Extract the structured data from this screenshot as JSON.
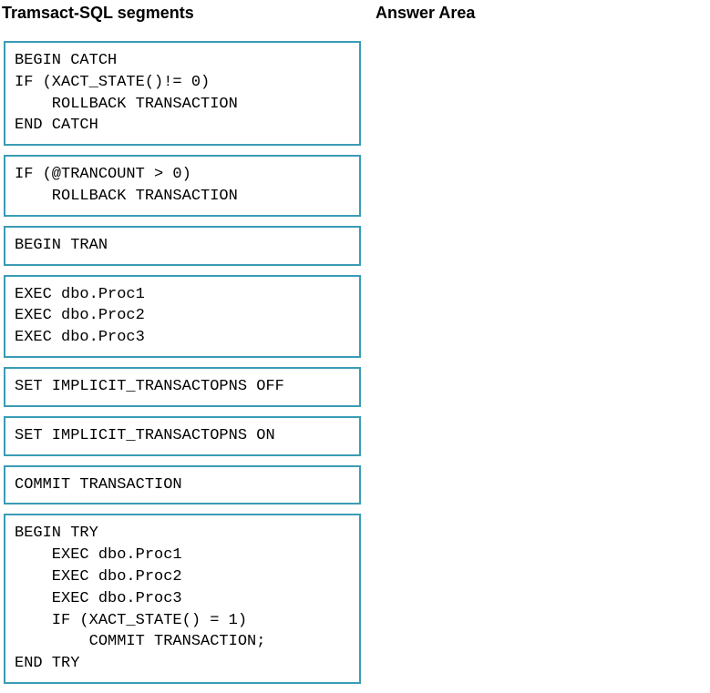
{
  "headings": {
    "left": "Tramsact-SQL segments",
    "right": "Answer Area"
  },
  "segments": [
    "BEGIN CATCH\nIF (XACT_STATE()!= 0)\n    ROLLBACK TRANSACTION\nEND CATCH",
    "IF (@TRANCOUNT > 0)\n    ROLLBACK TRANSACTION",
    "BEGIN TRAN",
    "EXEC dbo.Proc1\nEXEC dbo.Proc2\nEXEC dbo.Proc3",
    "SET IMPLICIT_TRANSACTOPNS OFF",
    "SET IMPLICIT_TRANSACTOPNS ON",
    "COMMIT TRANSACTION",
    "BEGIN TRY\n    EXEC dbo.Proc1\n    EXEC dbo.Proc2\n    EXEC dbo.Proc3\n    IF (XACT_STATE() = 1)\n        COMMIT TRANSACTION;\nEND TRY"
  ]
}
